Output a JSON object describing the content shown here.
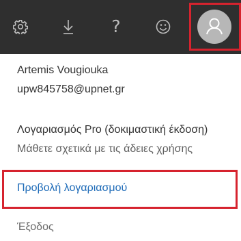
{
  "topbar": {
    "icons": [
      "gear-icon",
      "download-icon",
      "help-icon",
      "smiley-icon"
    ],
    "help_glyph": "?",
    "avatar_icon": "user-avatar-icon",
    "highlight_color": "#d6232e"
  },
  "account": {
    "name": "Artemis Vougiouka",
    "email": "upw845758@upnet.gr",
    "plan": "Λογαριασμός Pro (δοκιμαστική έκδοση)",
    "learn_more": "Μάθετε σχετικά με τις άδειες χρήσης",
    "view_account": "Προβολή λογαριασμού",
    "sign_out": "Έξοδος"
  }
}
